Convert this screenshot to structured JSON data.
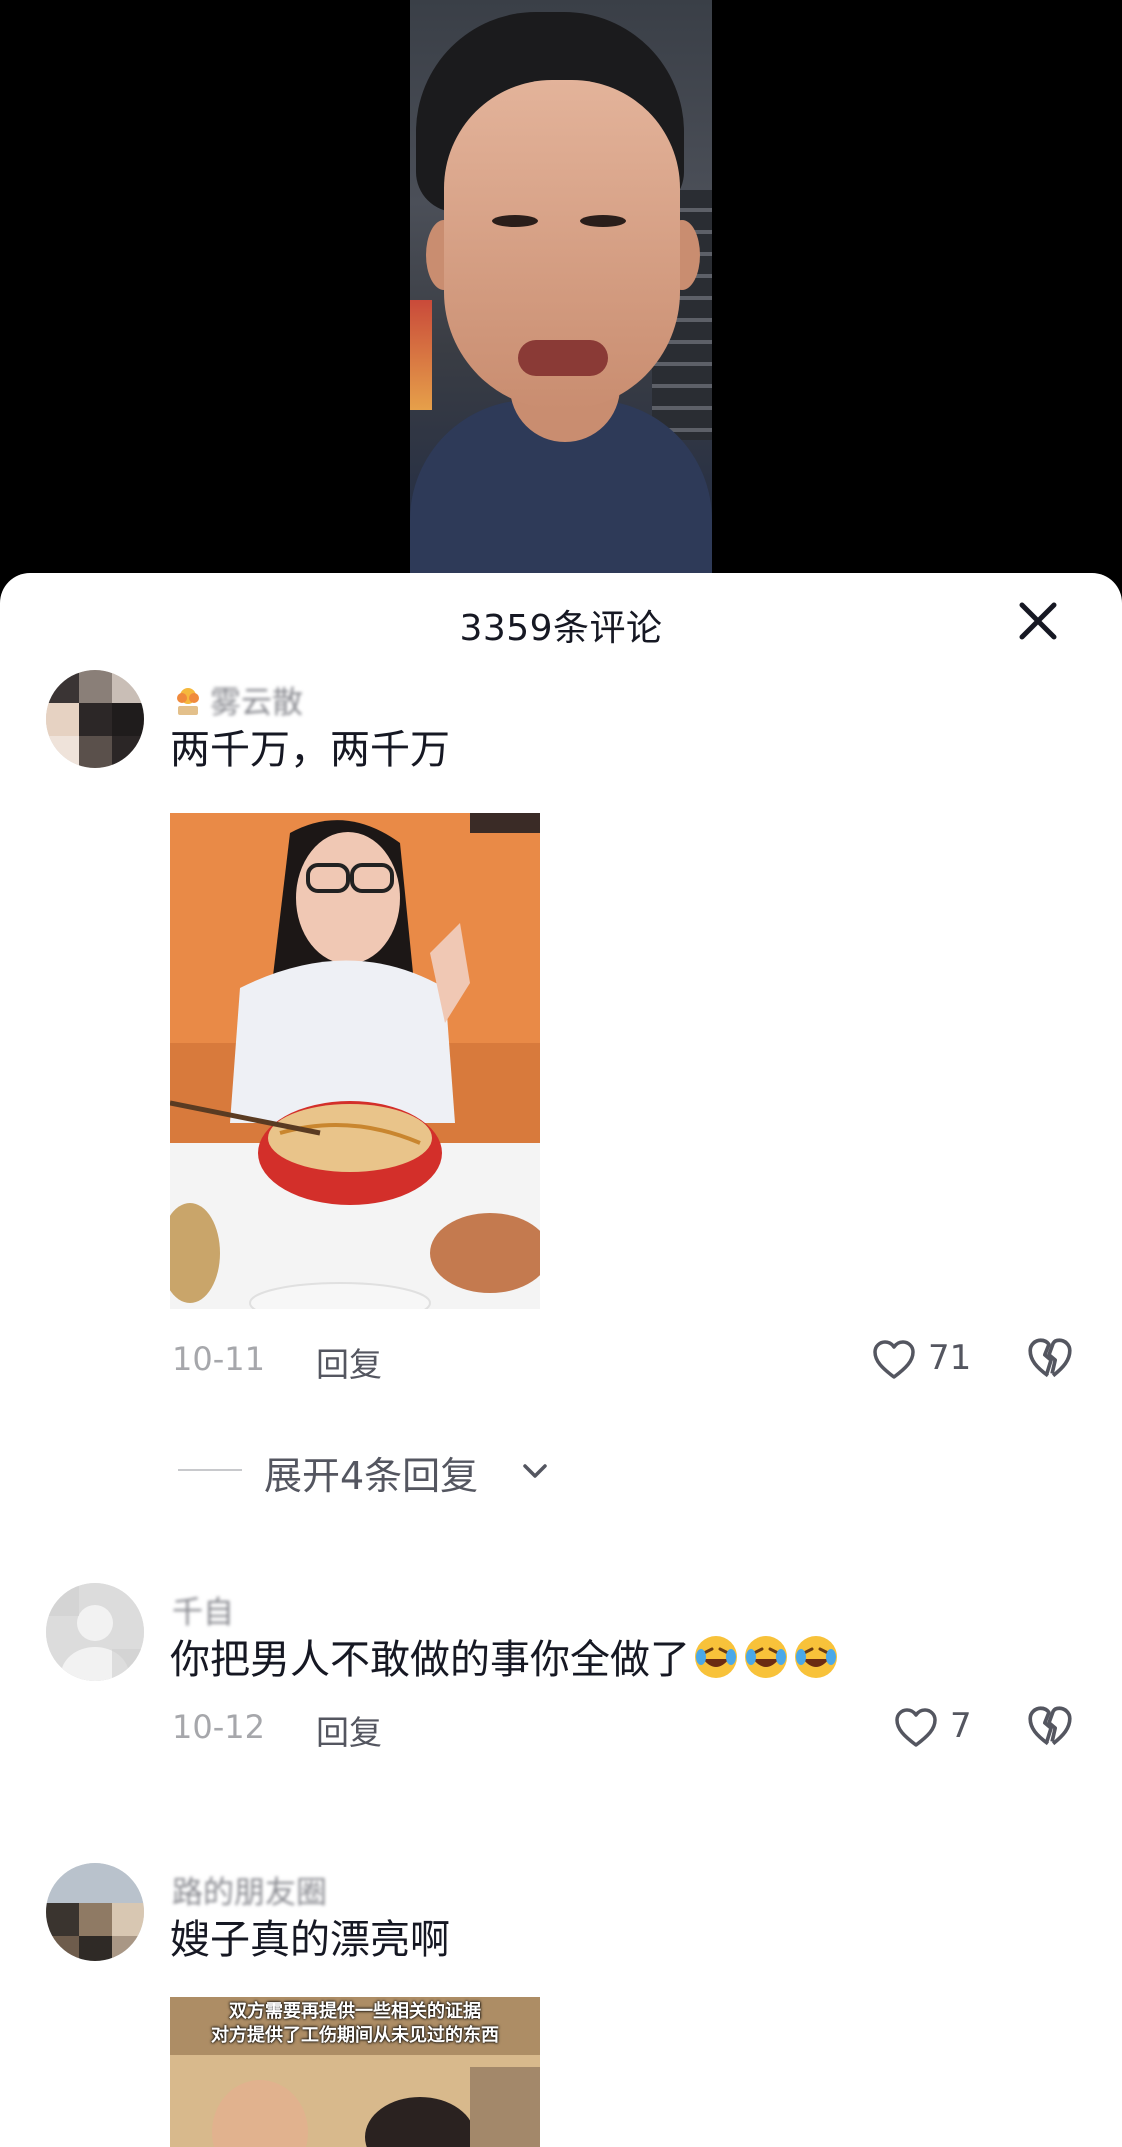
{
  "panel": {
    "title": "3359条评论"
  },
  "comments": [
    {
      "username": "雾云散",
      "text": "两千万，两千万",
      "date": "10-11",
      "reply_label": "回复",
      "likes": "71",
      "expand_label": "展开4条回复"
    },
    {
      "username": "千自",
      "text": "你把男人不敢做的事你全做了",
      "date": "10-12",
      "reply_label": "回复",
      "likes": "7"
    },
    {
      "username": "路的朋友圈",
      "text": "嫂子真的漂亮啊",
      "image_caption_line1": "双方需要再提供一些相关的证据",
      "image_caption_line2": "对方提供了工伤期间从未见过的东西"
    }
  ],
  "icons": {
    "close": "close-icon",
    "like": "heart-icon",
    "dislike": "broken-heart-icon",
    "expand": "chevron-down-icon",
    "emoji": "rolling-laughing-emoji"
  },
  "colors": {
    "text_primary": "#161823",
    "text_secondary": "#8a8b91",
    "text_meta": "#a6a7ab",
    "panel_bg": "#ffffff"
  }
}
